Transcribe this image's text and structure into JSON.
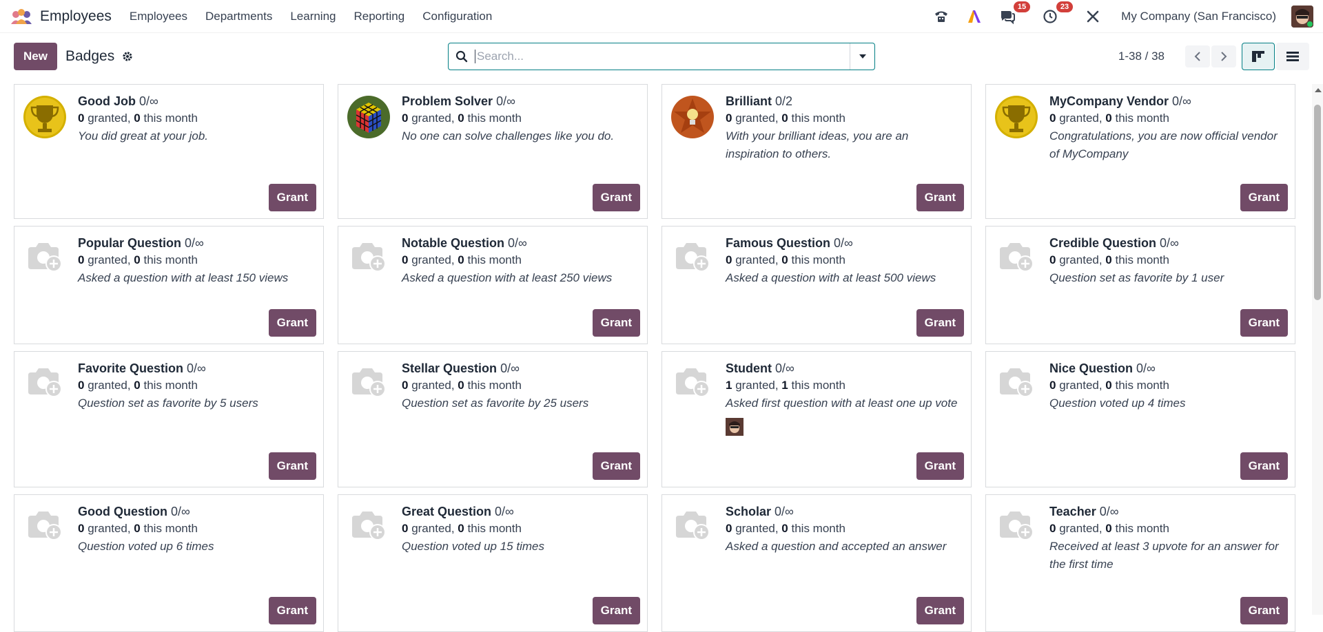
{
  "navbar": {
    "app_name": "Employees",
    "menu": [
      "Employees",
      "Departments",
      "Learning",
      "Reporting",
      "Configuration"
    ],
    "messages_count": "15",
    "activities_count": "23",
    "company": "My Company (San Francisco)"
  },
  "control": {
    "new_label": "New",
    "title": "Badges",
    "search_placeholder": "Search...",
    "pager": "1-38 / 38"
  },
  "cards": [
    {
      "name": "Good Job",
      "limit": "0/∞",
      "granted": "0",
      "month": "0",
      "desc": "You did great at your job.",
      "icon": "trophy-icon",
      "grant": "Grant"
    },
    {
      "name": "Problem Solver",
      "limit": "0/∞",
      "granted": "0",
      "month": "0",
      "desc": "No one can solve challenges like you do.",
      "icon": "rubik-cube-icon",
      "grant": "Grant"
    },
    {
      "name": "Brilliant",
      "limit": "0/2",
      "granted": "0",
      "month": "0",
      "desc": "With your brilliant ideas, you are an inspiration to others.",
      "icon": "lightbulb-star-icon",
      "grant": "Grant"
    },
    {
      "name": "MyCompany Vendor",
      "limit": "0/∞",
      "granted": "0",
      "month": "0",
      "desc": "Congratulations, you are now official vendor of MyCompany",
      "icon": "trophy-icon",
      "grant": "Grant"
    },
    {
      "name": "Popular Question",
      "limit": "0/∞",
      "granted": "0",
      "month": "0",
      "desc": "Asked a question with at least 150 views",
      "icon": "camera-placeholder-icon",
      "grant": "Grant"
    },
    {
      "name": "Notable Question",
      "limit": "0/∞",
      "granted": "0",
      "month": "0",
      "desc": "Asked a question with at least 250 views",
      "icon": "camera-placeholder-icon",
      "grant": "Grant"
    },
    {
      "name": "Famous Question",
      "limit": "0/∞",
      "granted": "0",
      "month": "0",
      "desc": "Asked a question with at least 500 views",
      "icon": "camera-placeholder-icon",
      "grant": "Grant"
    },
    {
      "name": "Credible Question",
      "limit": "0/∞",
      "granted": "0",
      "month": "0",
      "desc": "Question set as favorite by 1 user",
      "icon": "camera-placeholder-icon",
      "grant": "Grant"
    },
    {
      "name": "Favorite Question",
      "limit": "0/∞",
      "granted": "0",
      "month": "0",
      "desc": "Question set as favorite by 5 users",
      "icon": "camera-placeholder-icon",
      "grant": "Grant"
    },
    {
      "name": "Stellar Question",
      "limit": "0/∞",
      "granted": "0",
      "month": "0",
      "desc": "Question set as favorite by 25 users",
      "icon": "camera-placeholder-icon",
      "grant": "Grant"
    },
    {
      "name": "Student",
      "limit": "0/∞",
      "granted": "1",
      "month": "1",
      "desc": "Asked first question with at least one up vote",
      "icon": "camera-placeholder-icon",
      "grant": "Grant"
    },
    {
      "name": "Nice Question",
      "limit": "0/∞",
      "granted": "0",
      "month": "0",
      "desc": "Question voted up 4 times",
      "icon": "camera-placeholder-icon",
      "grant": "Grant"
    },
    {
      "name": "Good Question",
      "limit": "0/∞",
      "granted": "0",
      "month": "0",
      "desc": "Question voted up 6 times",
      "icon": "camera-placeholder-icon",
      "grant": "Grant"
    },
    {
      "name": "Great Question",
      "limit": "0/∞",
      "granted": "0",
      "month": "0",
      "desc": "Question voted up 15 times",
      "icon": "camera-placeholder-icon",
      "grant": "Grant"
    },
    {
      "name": "Scholar",
      "limit": "0/∞",
      "granted": "0",
      "month": "0",
      "desc": "Asked a question and accepted an answer",
      "icon": "camera-placeholder-icon",
      "grant": "Grant"
    },
    {
      "name": "Teacher",
      "limit": "0/∞",
      "granted": "0",
      "month": "0",
      "desc": "Received at least 3 upvote for an answer for the first time",
      "icon": "camera-placeholder-icon",
      "grant": "Grant"
    }
  ],
  "labels": {
    "granted": " granted, ",
    "this_month": " this month"
  },
  "colors": {
    "primary": "#714b67",
    "accent": "#017e84",
    "badge": "#d23f3a"
  }
}
